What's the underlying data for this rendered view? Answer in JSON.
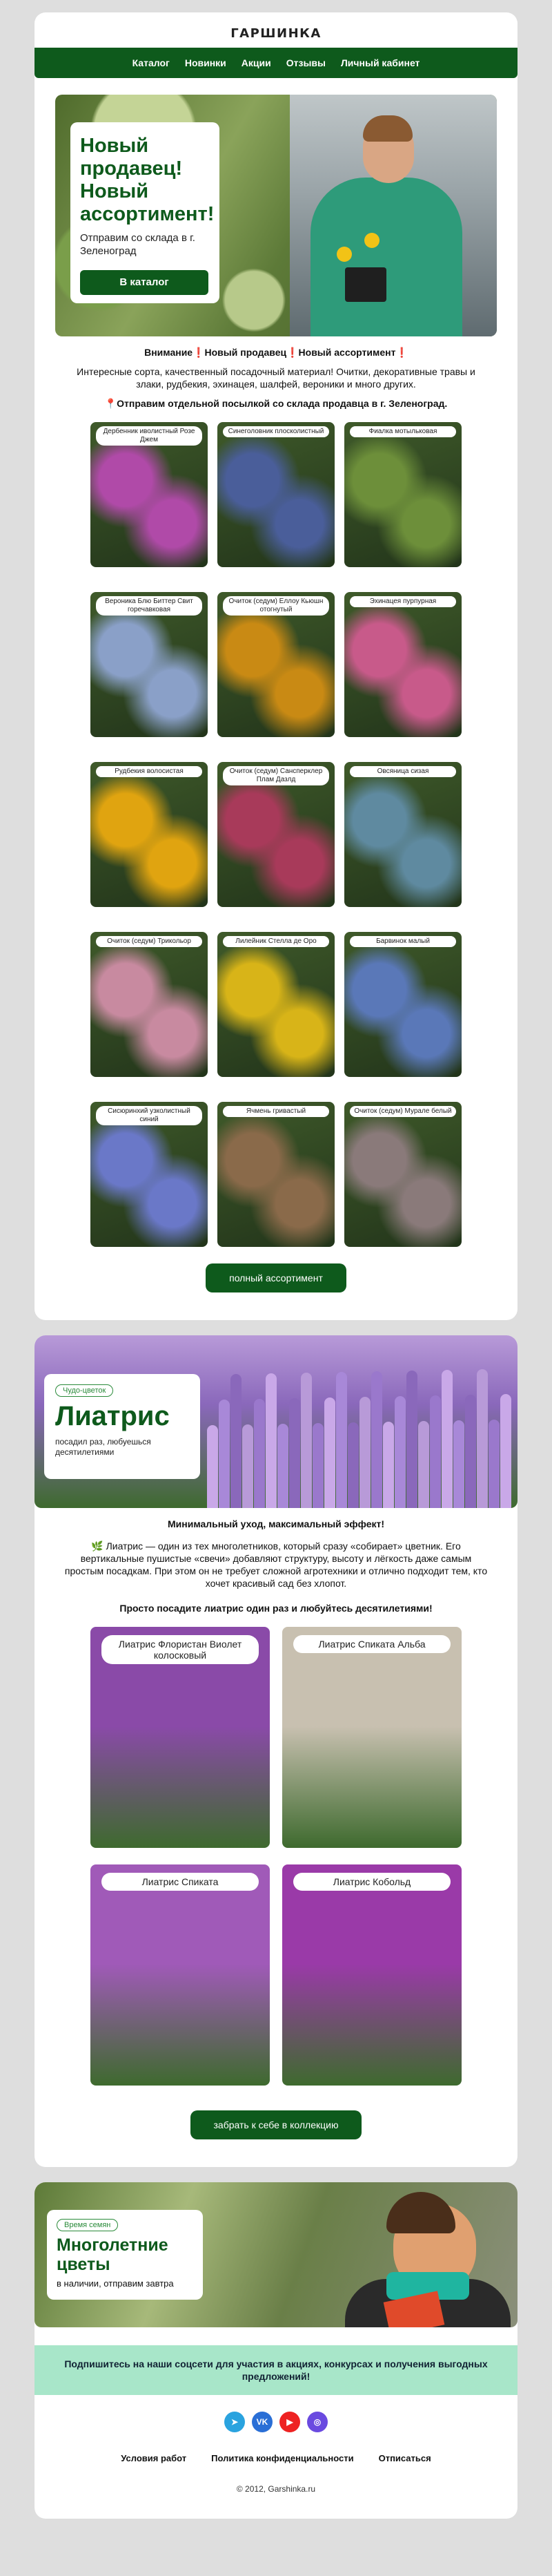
{
  "header": {
    "logo_text": "ГАРШИНКА",
    "nav": [
      "Каталог",
      "Новинки",
      "Акции",
      "Отзывы",
      "Личный кабинет"
    ]
  },
  "hero": {
    "title": "Новый продавец! Новый ассортимент!",
    "subtitle": "Отправим со склада в г. Зеленоград",
    "button": "В каталог"
  },
  "intro": {
    "headline": "Внимание❗Новый продавец❗Новый ассортимент❗",
    "body": "Интересные сорта, качественный посадочный материал! Очитки, декоративные травы и злаки, рудбекия, эхинацея, шалфей, вероники и много других.",
    "note": "📍Отправим отдельной посылкой со склада продавца в г. Зеленоград."
  },
  "products": [
    {
      "label": "Дербенник иволистный Розе Джем",
      "color": "#b04aa8"
    },
    {
      "label": "Синеголовник плосколистный",
      "color": "#4a5e9a"
    },
    {
      "label": "Фиалка мотыльковая",
      "color": "#6d8f3a"
    },
    {
      "label": "Вероника Блю Биттер Свит горечавковая",
      "color": "#8aa0c8"
    },
    {
      "label": "Очиток (седум) Еллоу Кьюшн отогнутый",
      "color": "#c98a14"
    },
    {
      "label": "Эхинацея пурпурная",
      "color": "#c85a8a"
    },
    {
      "label": "Рудбекия волосистая",
      "color": "#e0a410"
    },
    {
      "label": "Очиток (седум) Сансперклер Плам Дазлд",
      "color": "#a83a5a"
    },
    {
      "label": "Овсяница сизая",
      "color": "#5f8aa0"
    },
    {
      "label": "Очиток (седум) Трикольор",
      "color": "#c88aa0"
    },
    {
      "label": "Лилейник Стелла де Оро",
      "color": "#d8b418"
    },
    {
      "label": "Барвинок малый",
      "color": "#5a78b8"
    },
    {
      "label": "Сисюринхий узколистный синий",
      "color": "#6a78c8"
    },
    {
      "label": "Ячмень гривастый",
      "color": "#8a6a4a"
    },
    {
      "label": "Очиток (седум) Мурале белый",
      "color": "#8a7a7a"
    }
  ],
  "cta1": "полный ассортимент",
  "liatris": {
    "tag": "Чудо-цветок",
    "title": "Лиатрис",
    "subtitle": "посадил раз, любуешься десятилетиями",
    "headline": "Минимальный уход, максимальный эффект!",
    "body": "🌿 Лиатрис — один из тех многолетников, который сразу «собирает» цветник. Его вертикальные пушистые «свечи» добавляют структуру, высоту и лёгкость даже самым простым посадкам. При этом он не требует сложной агротехники и отлично подходит тем, кто хочет красивый сад без хлопот.",
    "tagline": "Просто посадите лиатрис один раз и любуйтесь десятилетиями!",
    "items": [
      {
        "label": "Лиатрис Флористан Виолет колосковый",
        "color": "#8a4aa8"
      },
      {
        "label": "Лиатрис Спиката Альба",
        "color": "#c8c0b0"
      },
      {
        "label": "Лиатрис Спиката",
        "color": "#a05ab8"
      },
      {
        "label": "Лиатрис Кобольд",
        "color": "#9a3aa8"
      }
    ],
    "button": "забрать к себе в коллекцию"
  },
  "seeds": {
    "tag": "Время семян",
    "title": "Многолетние цветы",
    "subtitle": "в наличии, отправим завтра"
  },
  "footer": {
    "social_text": "Подпишитесь на наши соцсети для участия в акциях, конкурсах и получения выгодных предложений!",
    "socials": [
      {
        "name": "telegram-icon",
        "glyph": "➤",
        "color": "#2aa3df"
      },
      {
        "name": "vk-icon",
        "glyph": "VK",
        "color": "#2a6fd6"
      },
      {
        "name": "youtube-icon",
        "glyph": "▶",
        "color": "#e22"
      },
      {
        "name": "max-icon",
        "glyph": "◎",
        "color": "#6a4ae0"
      }
    ],
    "links": [
      "Условия работ",
      "Политика конфиденциальности",
      "Отписаться"
    ],
    "copyright": "© 2012, Garshinka.ru"
  }
}
